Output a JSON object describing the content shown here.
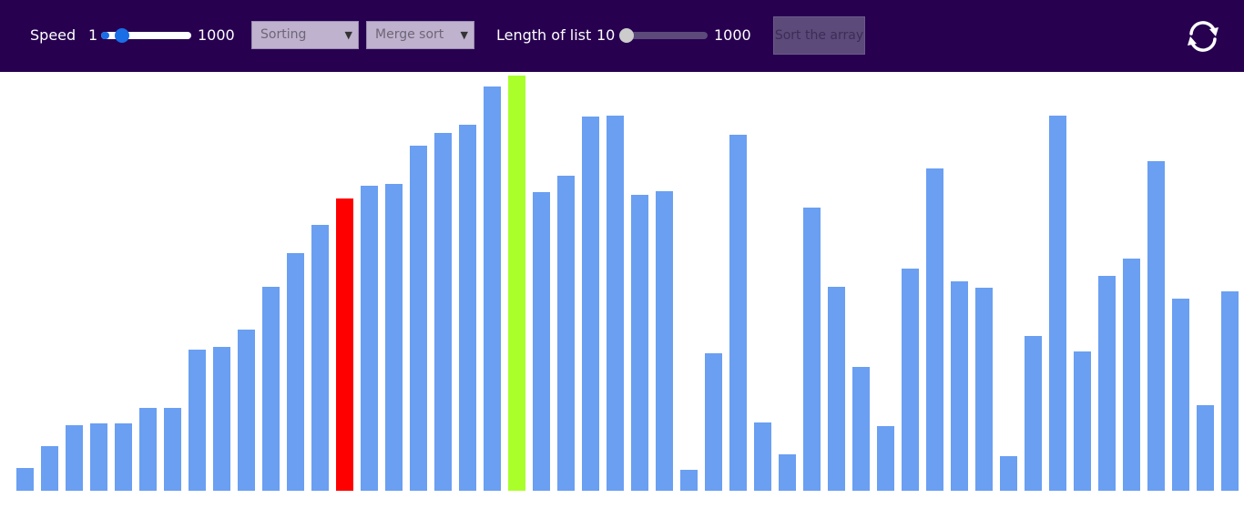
{
  "toolbar": {
    "speed_label": "Speed",
    "speed_min": "1",
    "speed_max": "1000",
    "speed_value_fraction": 0.09,
    "algorithm_type": "Sorting",
    "algorithm": "Merge sort",
    "length_label": "Length of list",
    "length_min": "10",
    "length_max": "1000",
    "length_value_fraction": 0.0,
    "sort_button": "Sort the array",
    "refresh_icon": "refresh-icon"
  },
  "colors": {
    "topbar": "#270050",
    "bar_default": "#6a9ff2",
    "bar_compare": "#ff0000",
    "bar_pivot": "#aaff2a",
    "slider_speed": "#1a6ee6",
    "slider_length": "#cccccc"
  },
  "chart_data": {
    "type": "bar",
    "ylim": [
      0,
      460
    ],
    "values": [
      25,
      49,
      72,
      74,
      74,
      91,
      91,
      155,
      158,
      177,
      224,
      261,
      292,
      321,
      335,
      337,
      379,
      393,
      402,
      444,
      456,
      328,
      346,
      411,
      412,
      325,
      329,
      23,
      151,
      391,
      75,
      40,
      311,
      224,
      136,
      71,
      244,
      354,
      230,
      223,
      38,
      170,
      412,
      153,
      236,
      255,
      362,
      211,
      94,
      219
    ],
    "highlight": {
      "compare_index": 13,
      "pivot_index": 20
    }
  }
}
